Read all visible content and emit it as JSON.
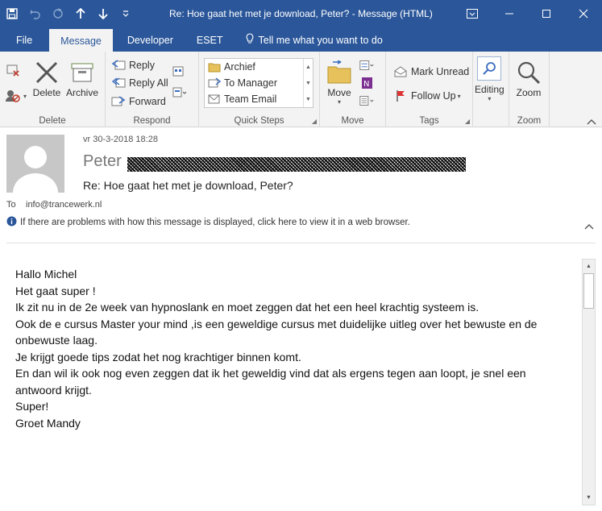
{
  "titlebar": {
    "title": "Re: Hoe gaat het met je download, Peter?  -  Message (HTML)",
    "icons": [
      "save-icon",
      "undo-icon",
      "redo-icon",
      "up-arrow-icon",
      "down-arrow-icon",
      "customize-icon"
    ],
    "window_buttons": [
      "ribbon-options-icon",
      "minimize-icon",
      "maximize-icon",
      "close-icon"
    ]
  },
  "tabs": [
    {
      "label": "File"
    },
    {
      "label": "Message"
    },
    {
      "label": "Developer"
    },
    {
      "label": "ESET"
    },
    {
      "label": "Tell me what you want to do"
    }
  ],
  "ribbon": {
    "delete_group": {
      "label": "Delete",
      "delete": "Delete",
      "archive": "Archive"
    },
    "respond_group": {
      "label": "Respond",
      "reply": "Reply",
      "reply_all": "Reply All",
      "forward": "Forward"
    },
    "quick_steps_group": {
      "label": "Quick Steps",
      "items": [
        "Archief",
        "To Manager",
        "Team Email"
      ]
    },
    "move_group": {
      "label": "Move",
      "move": "Move"
    },
    "tags_group": {
      "label": "Tags",
      "mark_unread": "Mark Unread",
      "follow_up": "Follow Up"
    },
    "editing_group": {
      "label": "",
      "editing": "Editing"
    },
    "zoom_group": {
      "label": "Zoom",
      "zoom": "Zoom"
    }
  },
  "header": {
    "date": "vr 30-3-2018 18:28",
    "sender": "Peter",
    "subject": "Re: Hoe gaat het met je download, Peter?",
    "to_label": "To",
    "to_value": "info@trancewerk.nl",
    "info": "If there are problems with how this message is displayed, click here to view it in a web browser."
  },
  "body": {
    "greeting": "Hallo Michel",
    "p1_l1": "Het gaat super !",
    "p1_l2": "Ik zit nu in de 2e week van hypnoslank en moet zeggen dat het een heel krachtig systeem is.",
    "p2_l1": "Ook de e cursus Master your mind ,is een geweldige cursus met duidelijke uitleg over het bewuste en de",
    "p2_l2": "onbewuste laag.",
    "p2_l3": "Je krijgt goede tips zodat het nog krachtiger binnen komt.",
    "p3_l1": "En dan wil ik ook nog even zeggen dat ik het geweldig vind dat als ergens tegen aan loopt, je snel een",
    "p3_l2": "antwoord krijgt.",
    "p3_l3": "Super!",
    "closing": "Groet Mandy"
  },
  "colors": {
    "titlebar": "#2b579a",
    "ribbon": "#f3f3f3",
    "accent": "#2b579a"
  }
}
